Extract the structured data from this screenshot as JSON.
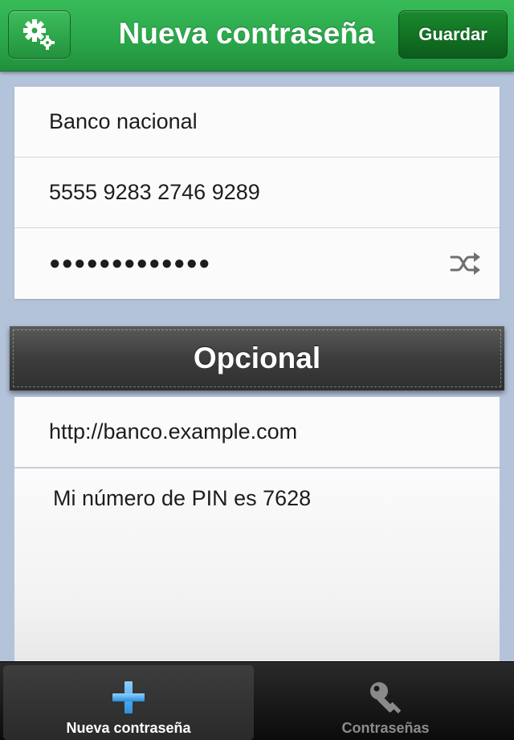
{
  "navbar": {
    "title": "Nueva contraseña",
    "settings_icon": "gears-icon",
    "save_label": "Guardar"
  },
  "fields": {
    "name": "Banco nacional",
    "account": "5555 9283 2746 9289",
    "password": "●●●●●●●●●●●●●",
    "shuffle_icon": "shuffle-icon"
  },
  "optional": {
    "header": "Opcional",
    "url": "http://banco.example.com",
    "notes": "Mi número de PIN es 7628"
  },
  "tabs": [
    {
      "label": "Nueva contraseña",
      "icon": "plus-icon",
      "active": true
    },
    {
      "label": "Contraseñas",
      "icon": "key-icon",
      "active": false
    }
  ],
  "colors": {
    "navbar_green": "#2ba84b",
    "save_green": "#0b5c1b",
    "background": "#b3c3d9",
    "tab_active_icon": "#4aa8e8"
  }
}
